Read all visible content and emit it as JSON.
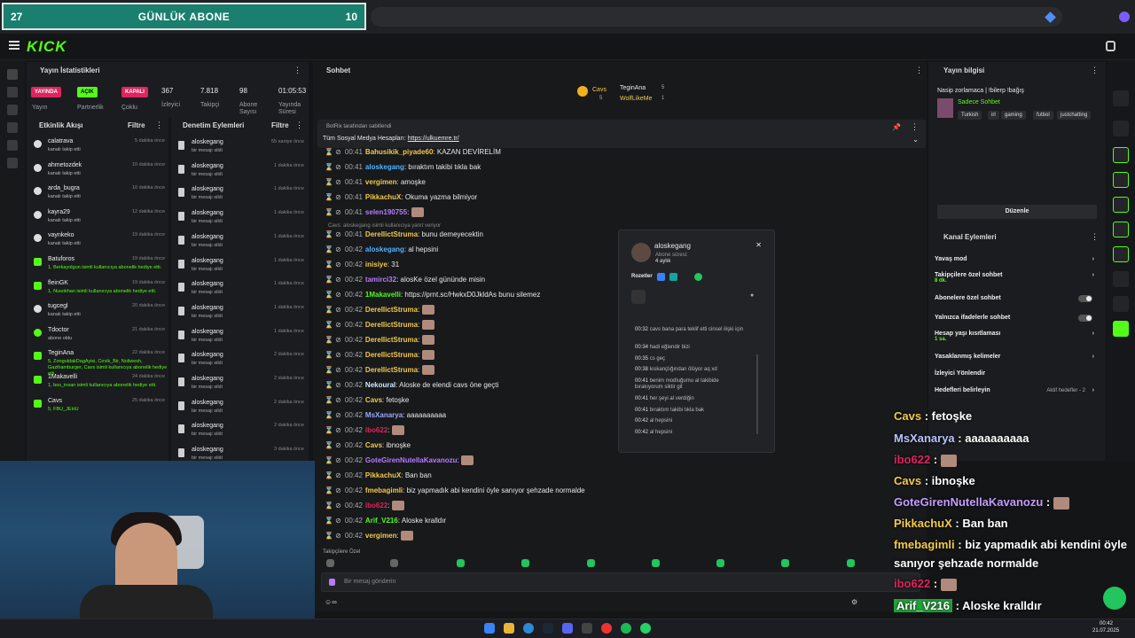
{
  "browser": {
    "abone_title": "GÜNLÜK ABONE",
    "abone_left": "27",
    "abone_right": "10"
  },
  "brand": "KICK",
  "stats": {
    "title": "Yayın İstatistikleri",
    "badges": [
      {
        "label": "YAYINDA",
        "color": "#e0245e"
      },
      {
        "label": "AÇIK",
        "color": "#53fc18"
      },
      {
        "label": "KAPALI",
        "color": "#e0245e"
      }
    ],
    "cols": [
      {
        "value": "",
        "label": "Yayın"
      },
      {
        "value": "",
        "label": "Partnerlik"
      },
      {
        "value": "",
        "label": "Çoklu"
      },
      {
        "value": "367",
        "label": "İzleyici"
      },
      {
        "value": "7.818",
        "label": "Takipçi"
      },
      {
        "value": "98",
        "label": "Abone Sayısı"
      },
      {
        "value": "01:05:53",
        "label": "Yayında Süresi"
      }
    ]
  },
  "feed": {
    "title": "Etkinlik Akışı",
    "filter": "Filtre",
    "items": [
      {
        "name": "calatrava",
        "sub": "kanalı takip etti",
        "time": "5 dakika önce",
        "icon": "heart-icon"
      },
      {
        "name": "ahmetozdek",
        "sub": "kanalı takip etti",
        "time": "10 dakika önce",
        "icon": "heart-icon"
      },
      {
        "name": "arda_bugra",
        "sub": "kanalı takip etti",
        "time": "10 dakika önce",
        "icon": "heart-icon"
      },
      {
        "name": "kayra29",
        "sub": "kanalı takip etti",
        "time": "12 dakika önce",
        "icon": "heart-icon"
      },
      {
        "name": "vaynkeko",
        "sub": "kanalı takip etti",
        "time": "19 dakika önce",
        "icon": "heart-icon"
      },
      {
        "name": "Batuforos",
        "sub": "1, Berkayolgun isimli kullanıcıya abonelik hediye etti.",
        "time": "19 dakika önce",
        "icon": "gift-icon"
      },
      {
        "name": "fleinGK",
        "sub": "1, Nusokhan isimli kullanıcıya abonelik hediye etti.",
        "time": "19 dakika önce",
        "icon": "gift-icon"
      },
      {
        "name": "tugcegl",
        "sub": "kanalı takip etti",
        "time": "20 dakika önce",
        "icon": "heart-icon"
      },
      {
        "name": "Tdoctor",
        "sub": "abone oldu",
        "time": "21 dakika önce",
        "icon": "star-icon"
      },
      {
        "name": "TeginAna",
        "sub": "5, ZonguldakDagAyisi, Cevik_Bir, Noliwesh, Gazihamburger, Cavs isimli kullanıcıya abonelik hediye etti.",
        "time": "22 dakika önce",
        "icon": "gift-icon"
      },
      {
        "name": "1Makavelli",
        "sub": "1, bos_insan isimli kullanıcıya abonelik hediye etti.",
        "time": "24 dakika önce",
        "icon": "gift-icon"
      },
      {
        "name": "Cavs",
        "sub": "5, FBU_JEHU",
        "time": "25 dakika önce",
        "icon": "gift-icon"
      }
    ]
  },
  "mod": {
    "title": "Denetim Eylemleri",
    "filter": "Filtre",
    "items": [
      {
        "name": "aloskegang",
        "sub": "bir mesajı sildi",
        "time": "55 saniye önce"
      },
      {
        "name": "aloskegang",
        "sub": "bir mesajı sildi",
        "time": "1 dakika önce"
      },
      {
        "name": "aloskegang",
        "sub": "bir mesajı sildi",
        "time": "1 dakika önce"
      },
      {
        "name": "aloskegang",
        "sub": "bir mesajı sildi",
        "time": "1 dakika önce"
      },
      {
        "name": "aloskegang",
        "sub": "bir mesajı sildi",
        "time": "1 dakika önce"
      },
      {
        "name": "aloskegang",
        "sub": "bir mesajı sildi",
        "time": "1 dakika önce"
      },
      {
        "name": "aloskegang",
        "sub": "bir mesajı sildi",
        "time": "1 dakika önce"
      },
      {
        "name": "aloskegang",
        "sub": "bir mesajı sildi",
        "time": "1 dakika önce"
      },
      {
        "name": "aloskegang",
        "sub": "bir mesajı sildi",
        "time": "1 dakika önce"
      },
      {
        "name": "aloskegang",
        "sub": "bir mesajı sildi",
        "time": "2 dakika önce"
      },
      {
        "name": "aloskegang",
        "sub": "bir mesajı sildi",
        "time": "2 dakika önce"
      },
      {
        "name": "aloskegang",
        "sub": "bir mesajı sildi",
        "time": "2 dakika önce"
      },
      {
        "name": "aloskegang",
        "sub": "bir mesajı sildi",
        "time": "2 dakika önce"
      },
      {
        "name": "aloskegang",
        "sub": "bir mesajı sildi",
        "time": "3 dakika önce"
      }
    ]
  },
  "chat": {
    "title": "Sohbet",
    "leaders": [
      {
        "name": "Cavs",
        "count": "5"
      },
      {
        "name": "TeginAna",
        "count": "5"
      },
      {
        "name": "WolfLikeMe",
        "count": "1"
      }
    ],
    "pinned_by": "BotRix tarafından sabitlendi",
    "pinned_text": "Tüm Sosyal Medya Hesapları:",
    "pinned_link": "https://ulkuemre.tr/",
    "reply_hint": "Cavs: aloskegang isimli kullanıcıya yanıt veriyor",
    "messages": [
      {
        "time": "00:41",
        "user": "Bahusikik_piyade60",
        "color": "#f2c94c",
        "text": "KAZAN DEVİRELİM"
      },
      {
        "time": "00:41",
        "user": "aloskegang",
        "color": "#4fb3ff",
        "text": "bıraktım takibi tıkla bak"
      },
      {
        "time": "00:41",
        "user": "vergimen",
        "color": "#f2c94c",
        "text": "amoşke"
      },
      {
        "time": "00:41",
        "user": "PikkachuX",
        "color": "#f2c94c",
        "text": "Okuma yazma bilmiyor"
      },
      {
        "time": "00:41",
        "user": "selen190755",
        "color": "#b57bff",
        "text": ""
      },
      {
        "time": "00:41",
        "user": "DerellictStruma",
        "color": "#f2c94c",
        "text": "bunu demeyecektin"
      },
      {
        "time": "00:42",
        "user": "aloskegang",
        "color": "#4fb3ff",
        "text": "al hepsini"
      },
      {
        "time": "00:42",
        "user": "inisiye",
        "color": "#f2c94c",
        "text": "31"
      },
      {
        "time": "00:42",
        "user": "tamirci32",
        "color": "#b57bff",
        "text": "alosKe özel gününde misin"
      },
      {
        "time": "00:42",
        "user": "1Makavelli",
        "color": "#53fc18",
        "text": "https://prnt.sc/HwkxD0JkldAs bunu silemez"
      },
      {
        "time": "00:42",
        "user": "DerellictStruma",
        "color": "#f2c94c",
        "text": ""
      },
      {
        "time": "00:42",
        "user": "DerellictStruma",
        "color": "#f2c94c",
        "text": ""
      },
      {
        "time": "00:42",
        "user": "DerellictStruma",
        "color": "#f2c94c",
        "text": ""
      },
      {
        "time": "00:42",
        "user": "DerellictStruma",
        "color": "#f2c94c",
        "text": ""
      },
      {
        "time": "00:42",
        "user": "DerellictStruma",
        "color": "#f2c94c",
        "text": ""
      },
      {
        "time": "00:42",
        "user": "Nekoural",
        "color": "#cfe8ff",
        "text": "Aloske de elendi cavs öne geçti"
      },
      {
        "time": "00:42",
        "user": "Cavs",
        "color": "#f2c94c",
        "text": "fetoşke"
      },
      {
        "time": "00:42",
        "user": "MsXanarya",
        "color": "#9aa8ff",
        "text": "aaaaaaaaaa"
      },
      {
        "time": "00:42",
        "user": "ibo622",
        "color": "#e0245e",
        "text": ""
      },
      {
        "time": "00:42",
        "user": "Cavs",
        "color": "#f2c94c",
        "text": "ibnoşke"
      },
      {
        "time": "00:42",
        "user": "GoteGirenNutellaKavanozu",
        "color": "#b57bff",
        "text": ""
      },
      {
        "time": "00:42",
        "user": "PikkachuX",
        "color": "#f2c94c",
        "text": "Ban ban"
      },
      {
        "time": "00:42",
        "user": "fmebagimli",
        "color": "#f2c94c",
        "text": "biz yapmadık abi kendini öyle sanıyor şehzade normalde"
      },
      {
        "time": "00:42",
        "user": "ibo622",
        "color": "#e0245e",
        "text": ""
      },
      {
        "time": "00:42",
        "user": "Arif_V216",
        "color": "#53fc18",
        "text": "Aloske kralldır"
      },
      {
        "time": "00:42",
        "user": "vergimen",
        "color": "#f2c94c",
        "text": ""
      }
    ],
    "followers_only": "Takipçilere Özel",
    "input_placeholder": "Bir mesaj gönderin"
  },
  "popup": {
    "user": "aloskegang",
    "sub_label": "Abone süresi:",
    "sub_value": "4 aylık",
    "badges_label": "Rozetler",
    "history": [
      {
        "time": "00:32",
        "text": "cavs bana para teklif etti cinsel ilişki için"
      },
      {
        "time": "00:34",
        "text": "hadi eğlendir bizi"
      },
      {
        "time": "00:35",
        "text": "cs geç"
      },
      {
        "time": "00:38",
        "text": "kıskançlığından ölüyor aq xd"
      },
      {
        "time": "00:41",
        "text": "benim modluğumu al takibide bırakıyorum siktir git"
      },
      {
        "time": "00:41",
        "text": "her şeyi al verdiğin"
      },
      {
        "time": "00:41",
        "text": "bıraktım takibi tıkla bak"
      },
      {
        "time": "00:42",
        "text": "al hepsini"
      },
      {
        "time": "00:42",
        "text": "al hepsini"
      }
    ]
  },
  "streaminfo": {
    "title": "Yayın bilgisi",
    "stream_title": "Nasip zorlamaca | !bilerp !bağış",
    "category": "Sadece Sohbet",
    "tags": [
      "Turkish",
      "irl",
      "gaming",
      "futbol",
      "justchatting"
    ],
    "edit": "Düzenle"
  },
  "actions": {
    "title": "Kanal Eylemleri",
    "items": [
      {
        "label": "Yavaş mod",
        "sub": "",
        "control": "arrow"
      },
      {
        "label": "Takipçilere özel sohbet",
        "sub": "8 dk.",
        "control": "arrow"
      },
      {
        "label": "Abonelere özel sohbet",
        "sub": "",
        "control": "toggle"
      },
      {
        "label": "Yalnızca ifadelerle sohbet",
        "sub": "",
        "control": "toggle"
      },
      {
        "label": "Hesap yaşı kısıtlaması",
        "sub": "1 sa.",
        "control": "arrow"
      },
      {
        "label": "Yasaklanmış kelimeler",
        "sub": "",
        "control": "arrow"
      },
      {
        "label": "İzleyici Yönlendir",
        "sub": "",
        "control": "none"
      },
      {
        "label": "Hedefleri belirleyin",
        "sub": "",
        "control": "arrow",
        "extra": "Aktif hedefler - 2"
      }
    ]
  },
  "overlay": {
    "lines": [
      {
        "user": "Cavs",
        "text": "fetoşke"
      },
      {
        "user": "MsXanarya",
        "text": "aaaaaaaaaa"
      },
      {
        "user": "ibo622",
        "text": ""
      },
      {
        "user": "Cavs",
        "text": "ibnoşke"
      },
      {
        "user": "GoteGirenNutellaKavanozu",
        "text": ""
      },
      {
        "user": "PikkachuX",
        "text": "Ban ban"
      },
      {
        "user": "fmebagimli",
        "text": "biz yapmadık abi kendini öyle"
      },
      {
        "user": "",
        "text": "sanıyor şehzade normalde"
      },
      {
        "user": "ibo622",
        "text": ""
      },
      {
        "user": "Arif_V216",
        "text": "Aloske kralldır"
      }
    ]
  },
  "taskbar": {
    "time": "00:42",
    "date": "21.07.2025"
  }
}
